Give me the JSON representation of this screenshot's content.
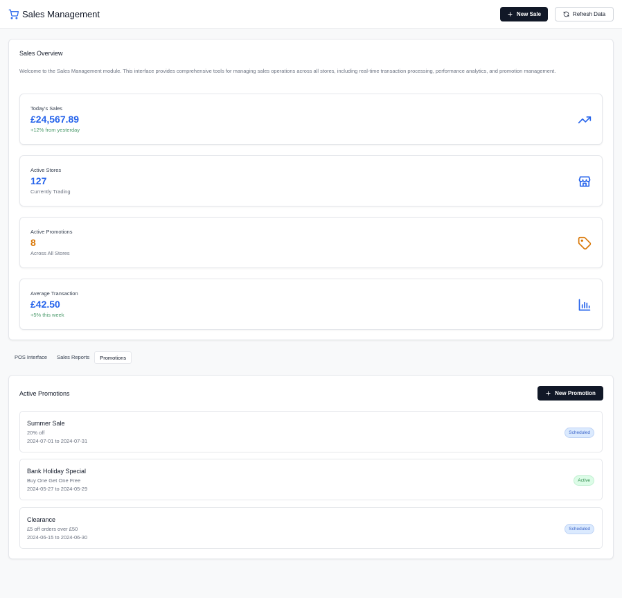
{
  "header": {
    "title": "Sales Management",
    "new_sale_label": "New Sale",
    "refresh_label": "Refresh Data"
  },
  "overview": {
    "title": "Sales Overview",
    "intro": "Welcome to the Sales Management module. This interface provides comprehensive tools for managing sales operations across all stores, including real-time transaction processing, performance analytics, and promotion management.",
    "stats": [
      {
        "label": "Today's Sales",
        "value": "£24,567.89",
        "sub": "+12% from yesterday",
        "icon": "trending-up-icon",
        "value_color": "#2563eb"
      },
      {
        "label": "Active Stores",
        "value": "127",
        "sub": "Currently Trading",
        "icon": "store-icon",
        "value_color": "#2563eb"
      },
      {
        "label": "Active Promotions",
        "value": "8",
        "sub": "Across All Stores",
        "icon": "tag-icon",
        "value_color": "#d97706"
      },
      {
        "label": "Average Transaction",
        "value": "£42.50",
        "sub": "+5% this week",
        "icon": "bar-chart-icon",
        "value_color": "#2563eb"
      }
    ]
  },
  "tabs": [
    {
      "label": "POS Interface",
      "active": false
    },
    {
      "label": "Sales Reports",
      "active": false
    },
    {
      "label": "Promotions",
      "active": true
    }
  ],
  "promotions": {
    "title": "Active Promotions",
    "new_label": "New Promotion",
    "items": [
      {
        "name": "Summer Sale",
        "desc": "20% off",
        "dates": "2024-07-01 to 2024-07-31",
        "status": "Scheduled"
      },
      {
        "name": "Bank Holiday Special",
        "desc": "Buy One Get One Free",
        "dates": "2024-05-27 to 2024-05-29",
        "status": "Active"
      },
      {
        "name": "Clearance",
        "desc": "£5 off orders over £50",
        "dates": "2024-06-15 to 2024-06-30",
        "status": "Scheduled"
      }
    ]
  },
  "colors": {
    "accent": "#2563eb",
    "dark": "#111827",
    "promo_orange": "#d97706",
    "positive_green": "#4b9a6b"
  }
}
